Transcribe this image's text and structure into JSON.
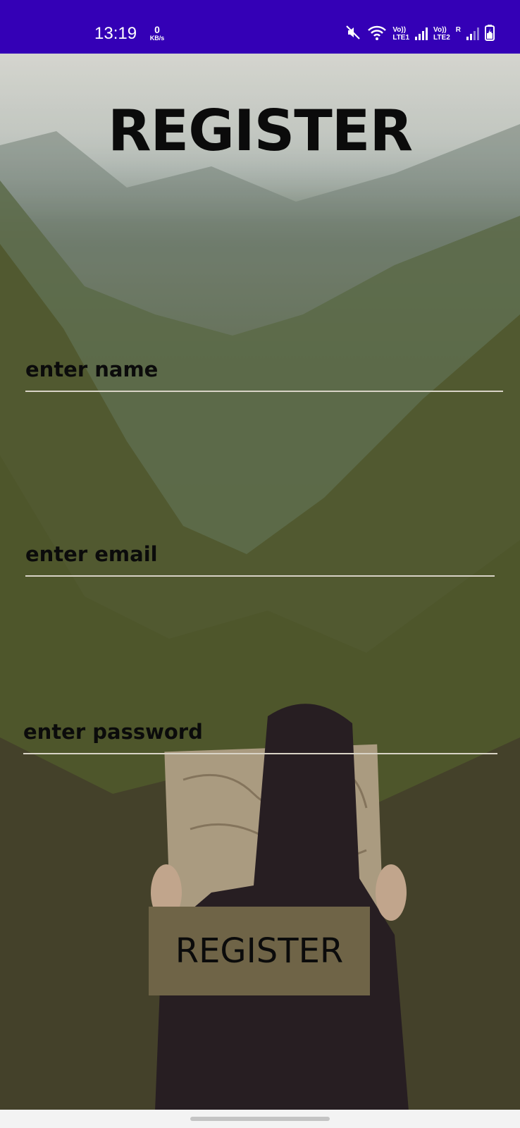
{
  "status_bar": {
    "time": "13:19",
    "data_rate_value": "0",
    "data_rate_unit": "KB/s",
    "sim1_label_top": "Vo))",
    "sim1_label_bottom": "LTE1",
    "sim2_label_top": "Vo))",
    "sim2_label_bottom": "LTE2",
    "sim2_roaming": "R",
    "icons": [
      "mute-icon",
      "wifi-icon",
      "signal-icon",
      "signal-icon",
      "battery-charging-icon"
    ]
  },
  "screen": {
    "title": "REGISTER",
    "fields": {
      "name_placeholder": "enter name",
      "email_placeholder": "enter email",
      "password_placeholder": "enter password"
    },
    "register_button": "REGISTER"
  },
  "colors": {
    "status_bar": "#3400b6",
    "button": "#6f6447",
    "text": "#0b0b0b"
  }
}
